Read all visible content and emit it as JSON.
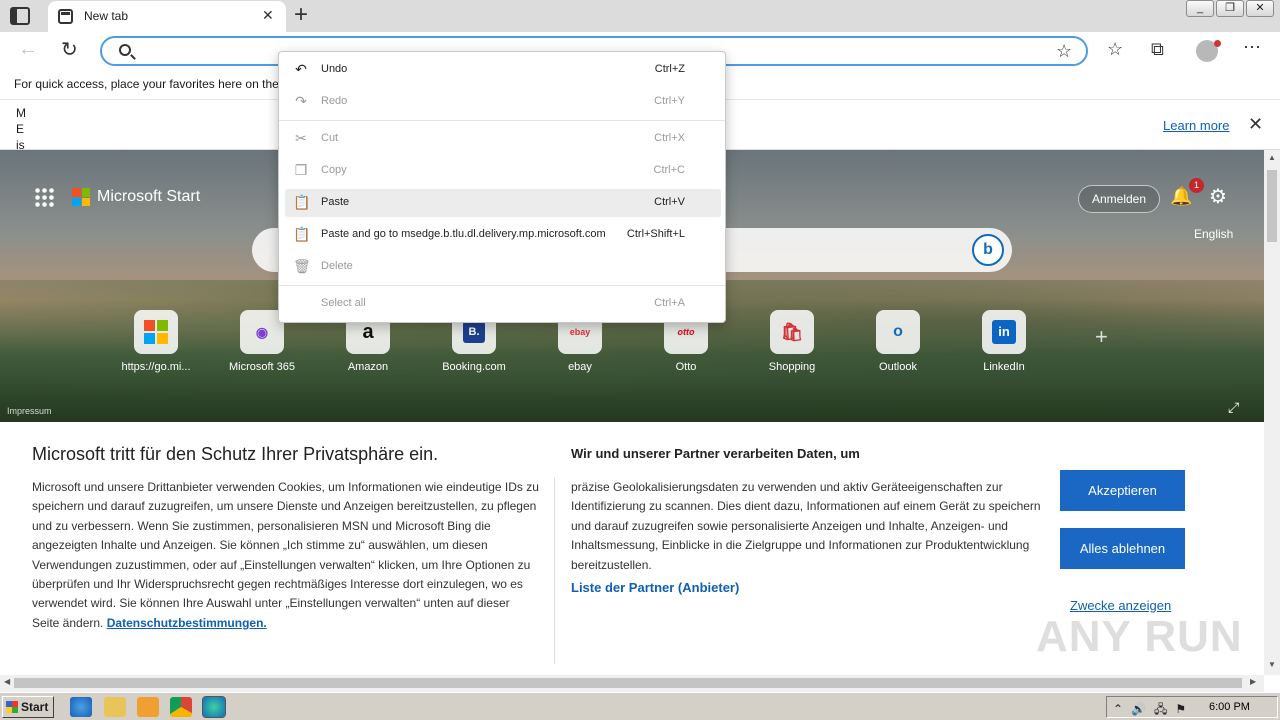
{
  "browser": {
    "tab_title": "New tab",
    "tab_close": "✕",
    "new_tab": "+",
    "address_value": "",
    "address_placeholder": "",
    "window_controls": [
      "_",
      "❐",
      "✕"
    ],
    "favorites_bar_text": "For quick access, place your favorites here on the f",
    "info_letters": "M E is",
    "learn_more": "Learn more",
    "info_close": "✕"
  },
  "context_menu": {
    "items": [
      {
        "label": "Undo",
        "shortcut": "Ctrl+Z",
        "icon": "undo-icon",
        "glyph": "↶",
        "disabled": false
      },
      {
        "label": "Redo",
        "shortcut": "Ctrl+Y",
        "icon": "redo-icon",
        "glyph": "↷",
        "disabled": true
      },
      {
        "label": "Cut",
        "shortcut": "Ctrl+X",
        "icon": "cut-icon",
        "glyph": "✂",
        "disabled": true
      },
      {
        "label": "Copy",
        "shortcut": "Ctrl+C",
        "icon": "copy-icon",
        "glyph": "❐",
        "disabled": true
      },
      {
        "label": "Paste",
        "shortcut": "Ctrl+V",
        "icon": "paste-icon",
        "glyph": "📋",
        "disabled": false
      },
      {
        "label": "Paste and go to msedge.b.tlu.dl.delivery.mp.microsoft.com",
        "shortcut": "Ctrl+Shift+L",
        "icon": "paste-go-icon",
        "glyph": "📋",
        "disabled": false
      },
      {
        "label": "Delete",
        "shortcut": "",
        "icon": "delete-icon",
        "glyph": "🗑",
        "disabled": true
      },
      {
        "label": "Select all",
        "shortcut": "Ctrl+A",
        "icon": "",
        "glyph": "",
        "disabled": true
      }
    ]
  },
  "start_page": {
    "brand": "Microsoft Start",
    "sign_in": "Anmelden",
    "notification_count": "1",
    "language": "English",
    "bing_label": "b",
    "tiles": [
      {
        "label": "https://go.mi...",
        "icon": "ms-tile-icon"
      },
      {
        "label": "Microsoft 365",
        "icon": "m365-icon"
      },
      {
        "label": "Amazon",
        "icon": "amazon-icon"
      },
      {
        "label": "Booking.com",
        "icon": "booking-icon"
      },
      {
        "label": "ebay",
        "icon": "ebay-icon"
      },
      {
        "label": "Otto",
        "icon": "otto-icon"
      },
      {
        "label": "Shopping",
        "icon": "shopping-icon"
      },
      {
        "label": "Outlook",
        "icon": "outlook-icon"
      },
      {
        "label": "LinkedIn",
        "icon": "linkedin-icon"
      }
    ],
    "tile_glyphs": [
      "",
      "◉",
      "a",
      "B.",
      "ebay",
      "otto",
      "🛍",
      "o",
      "in"
    ],
    "impressum": "Impressum"
  },
  "consent": {
    "title": "Microsoft tritt für den Schutz Ihrer Privatsphäre ein.",
    "body": "Microsoft und unsere Drittanbieter verwenden Cookies, um Informationen wie eindeutige IDs zu speichern und darauf zuzugreifen, um unsere Dienste und Anzeigen bereitzustellen, zu pflegen und zu verbessern. Wenn Sie zustimmen, personalisieren MSN und Microsoft Bing die angezeigten Inhalte und Anzeigen. Sie können „Ich stimme zu“ auswählen, um diesen Verwendungen zuzustimmen, oder auf „Einstellungen verwalten“ klicken, um Ihre Optionen zu überprüfen und Ihr Widerspruchsrecht gegen rechtmäßiges Interesse dort einzulegen, wo es verwendet wird.  Sie können Ihre Auswahl unter „Einstellungen verwalten“ unten auf dieser Seite ändern.",
    "privacy_link": "Datenschutzbestimmungen.",
    "partners_heading": "Wir und unserer Partner verarbeiten Daten, um",
    "partners_body": "präzise Geolokalisierungsdaten zu verwenden und aktiv Geräteeigenschaften zur Identifizierung zu scannen. Dies dient dazu, Informationen auf einem Gerät zu speichern und darauf zuzugreifen sowie personalisierte Anzeigen und Inhalte, Anzeigen- und Inhaltsmessung, Einblicke in die Zielgruppe und Informationen zur Produktentwicklung bereitzustellen.",
    "partners_link": "Liste der Partner (Anbieter)",
    "accept": "Akzeptieren",
    "reject": "Alles ablehnen",
    "purposes": "Zwecke anzeigen"
  },
  "watermark": "ANY RUN",
  "taskbar": {
    "start": "Start",
    "clock": "6:00 PM",
    "tray_icons": "⌃🔊🖧⚑"
  },
  "colors": {
    "accent": "#1a67c4",
    "link": "#0f5fb5",
    "address_border": "#4c9be6"
  }
}
